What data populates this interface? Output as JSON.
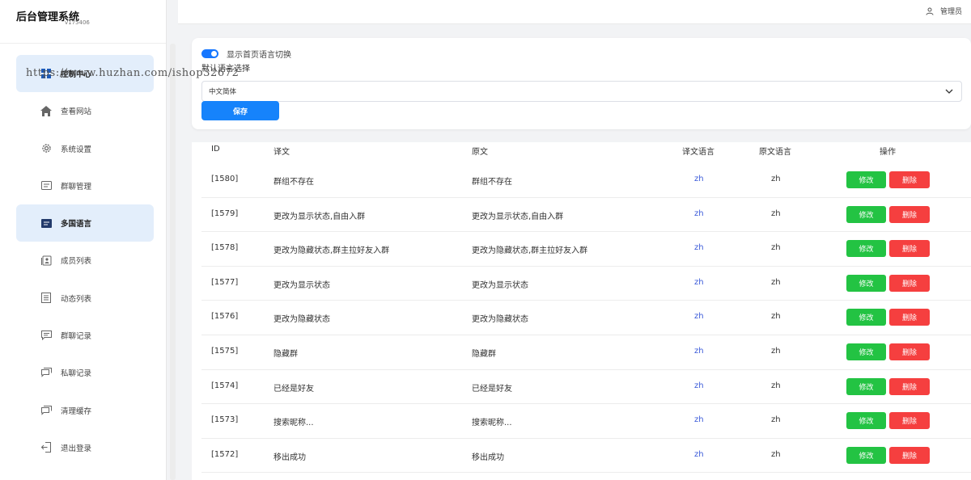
{
  "app": {
    "title": "后台管理系统",
    "version": "v175406"
  },
  "header": {
    "user_label": "管理员"
  },
  "sidebar": {
    "items": [
      {
        "label": "控制中心",
        "icon": "dashboard-icon",
        "active": true
      },
      {
        "label": "查看网站",
        "icon": "home-icon",
        "active": false
      },
      {
        "label": "系统设置",
        "icon": "gear-icon",
        "active": false
      },
      {
        "label": "群聊管理",
        "icon": "list-icon",
        "active": false
      },
      {
        "label": "多国语言",
        "icon": "language-icon",
        "active": true
      },
      {
        "label": "成员列表",
        "icon": "members-icon",
        "active": false
      },
      {
        "label": "动态列表",
        "icon": "feed-icon",
        "active": false
      },
      {
        "label": "群聊记录",
        "icon": "group-chat-icon",
        "active": false
      },
      {
        "label": "私聊记录",
        "icon": "private-chat-icon",
        "active": false
      },
      {
        "label": "清理缓存",
        "icon": "clear-cache-icon",
        "active": false
      },
      {
        "label": "退出登录",
        "icon": "logout-icon",
        "active": false
      }
    ]
  },
  "settings": {
    "toggle_label": "显示首页语言切换",
    "toggle_on": true,
    "default_lang_label": "默认语言选择",
    "selected_lang": "中文简体",
    "save_label": "保存"
  },
  "table": {
    "headers": [
      "ID",
      "译文",
      "原文",
      "译文语言",
      "原文语言",
      "操作"
    ],
    "rows": [
      {
        "id": "[1580]",
        "translation": "群组不存在",
        "original": "群组不存在",
        "trans_lang": "zh",
        "orig_lang": "zh"
      },
      {
        "id": "[1579]",
        "translation": "更改为显示状态,自由入群",
        "original": "更改为显示状态,自由入群",
        "trans_lang": "zh",
        "orig_lang": "zh"
      },
      {
        "id": "[1578]",
        "translation": "更改为隐藏状态,群主拉好友入群",
        "original": "更改为隐藏状态,群主拉好友入群",
        "trans_lang": "zh",
        "orig_lang": "zh"
      },
      {
        "id": "[1577]",
        "translation": "更改为显示状态",
        "original": "更改为显示状态",
        "trans_lang": "zh",
        "orig_lang": "zh"
      },
      {
        "id": "[1576]",
        "translation": "更改为隐藏状态",
        "original": "更改为隐藏状态",
        "trans_lang": "zh",
        "orig_lang": "zh"
      },
      {
        "id": "[1575]",
        "translation": "隐藏群",
        "original": "隐藏群",
        "trans_lang": "zh",
        "orig_lang": "zh"
      },
      {
        "id": "[1574]",
        "translation": "已经是好友",
        "original": "已经是好友",
        "trans_lang": "zh",
        "orig_lang": "zh"
      },
      {
        "id": "[1573]",
        "translation": "搜索昵称...",
        "original": "搜索昵称...",
        "trans_lang": "zh",
        "orig_lang": "zh"
      },
      {
        "id": "[1572]",
        "translation": "移出成功",
        "original": "移出成功",
        "trans_lang": "zh",
        "orig_lang": "zh"
      }
    ],
    "edit_label": "修改",
    "delete_label": "删除"
  },
  "watermark": "https://www.huzhan.com/ishop32672",
  "colors": {
    "primary": "#1683fb",
    "edit": "#23c343",
    "delete": "#f53f3f",
    "active_menu": "#e3eefb",
    "lang_text": "#3a5ad9"
  }
}
